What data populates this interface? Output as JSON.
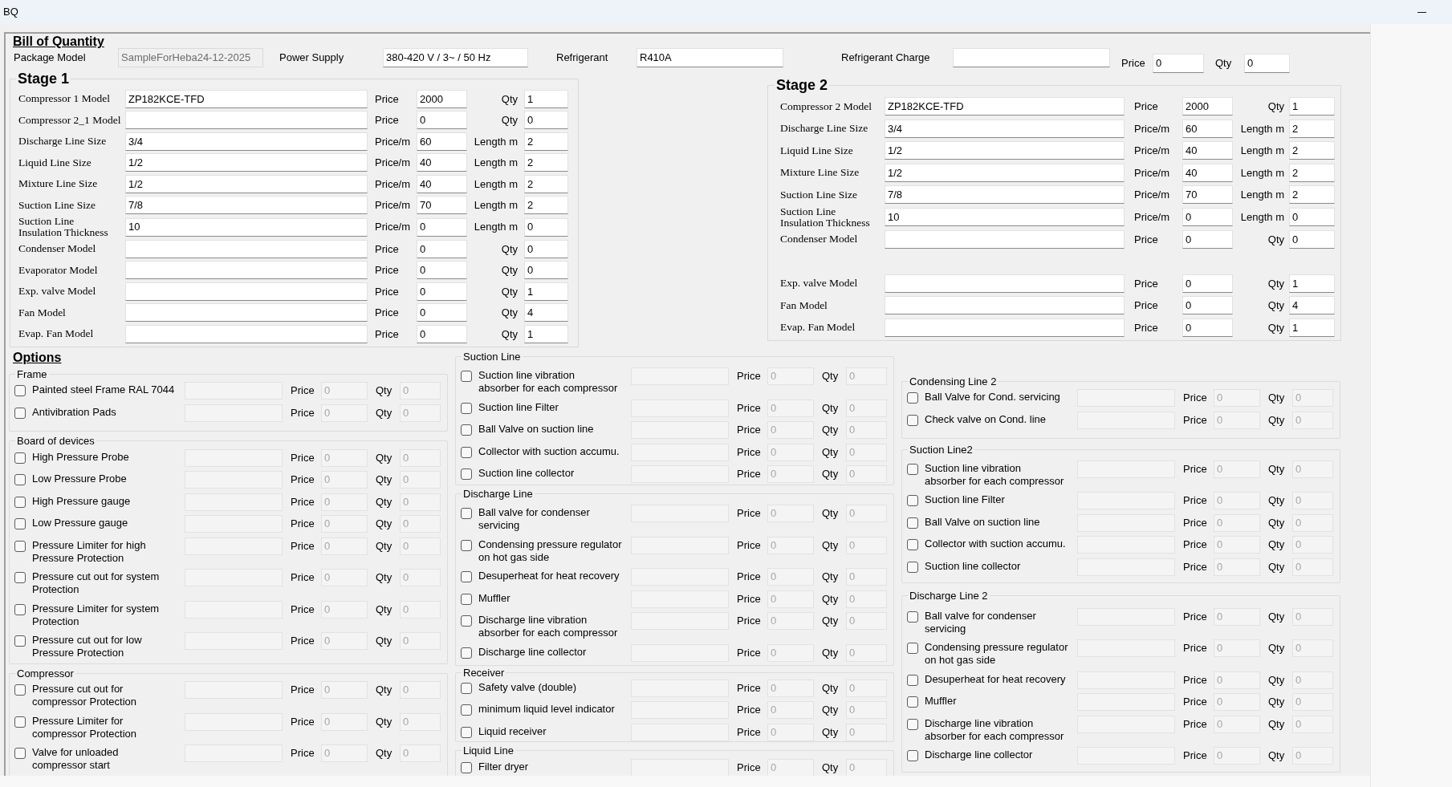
{
  "window": {
    "title": "BQ"
  },
  "header": {
    "title": "Bill of Quantity",
    "fields": [
      {
        "label": "Package Model",
        "value": "SampleForHeba24-12-2025",
        "disabled": true
      },
      {
        "label": "Power Supply",
        "value": "380-420 V / 3~ / 50 Hz",
        "disabled": false
      },
      {
        "label": "Refrigerant",
        "value": "R410A",
        "disabled": false
      },
      {
        "label": "Refrigerant Charge",
        "disabled": false
      }
    ],
    "price_label": "Price",
    "price": "0",
    "quantity_label": "Qty",
    "quantity": "0"
  },
  "stage_1": {
    "title": "Stage 1",
    "rows": [
      {
        "label": "Compressor 1 Model",
        "value": "ZP182KCE-TFD",
        "price_label": "Price",
        "price": "2000",
        "quantity_label": "Qty",
        "quantity": "1"
      },
      {
        "label": "Compressor 2_1 Model",
        "price_label": "Price",
        "price": "0",
        "quantity_label": "Qty",
        "quantity": "0"
      },
      {
        "label": "Discharge Line Size",
        "value": "3/4",
        "price_label": "Price/m",
        "price": "60",
        "quantity_label": "Length m",
        "quantity": "2"
      },
      {
        "label": "Liquid Line Size",
        "value": "1/2",
        "price_label": "Price/m",
        "price": "40",
        "quantity_label": "Length m",
        "quantity": "2"
      },
      {
        "label": "Mixture Line Size",
        "value": "1/2",
        "price_label": "Price/m",
        "price": "40",
        "quantity_label": "Length m",
        "quantity": "2"
      },
      {
        "label": "Suction Line Size",
        "value": "7/8",
        "price_label": "Price/m",
        "price": "70",
        "quantity_label": "Length m",
        "quantity": "2"
      },
      {
        "label": "Suction Line\nInsulation Thickness",
        "value": "10",
        "price_label": "Price/m",
        "price": "0",
        "quantity_label": "Length m",
        "quantity": "0"
      },
      {
        "label": "Condenser Model",
        "price_label": "Price",
        "price": "0",
        "quantity_label": "Qty",
        "quantity": "0"
      },
      {
        "label": "Evaporator Model",
        "price_label": "Price",
        "price": "0",
        "quantity_label": "Qty",
        "quantity": "0"
      },
      {
        "label": "Exp. valve Model",
        "price_label": "Price",
        "price": "0",
        "quantity_label": "Qty",
        "quantity": "1"
      },
      {
        "label": "Fan Model",
        "price_label": "Price",
        "price": "0",
        "quantity_label": "Qty",
        "quantity": "4"
      },
      {
        "label": "Evap. Fan Model",
        "price_label": "Price",
        "price": "0",
        "quantity_label": "Qty",
        "quantity": "1"
      }
    ]
  },
  "stage_2": {
    "title": "Stage 2",
    "row_groups": [
      [
        {
          "label": "Compressor 2 Model",
          "value": "ZP182KCE-TFD",
          "price_label": "Price",
          "price": "2000",
          "quantity_label": "Qty",
          "quantity": "1"
        },
        {
          "label": "Discharge Line Size",
          "value": "3/4",
          "price_label": "Price/m",
          "price": "60",
          "quantity_label": "Length m",
          "quantity": "2"
        },
        {
          "label": "Liquid Line Size",
          "value": "1/2",
          "price_label": "Price/m",
          "price": "40",
          "quantity_label": "Length m",
          "quantity": "2"
        },
        {
          "label": "Mixture Line Size",
          "value": "1/2",
          "price_label": "Price/m",
          "price": "40",
          "quantity_label": "Length m",
          "quantity": "2"
        },
        {
          "label": "Suction Line Size",
          "value": "7/8",
          "price_label": "Price/m",
          "price": "70",
          "quantity_label": "Length m",
          "quantity": "2"
        },
        {
          "label": "Suction Line\nInsulation Thickness",
          "value": "10",
          "price_label": "Price/m",
          "price": "0",
          "quantity_label": "Length m",
          "quantity": "0"
        },
        {
          "label": "Condenser Model",
          "price_label": "Price",
          "price": "0",
          "quantity_label": "Qty",
          "quantity": "0"
        }
      ],
      [
        {
          "label": "Exp. valve Model",
          "price_label": "Price",
          "price": "0",
          "quantity_label": "Qty",
          "quantity": "1"
        },
        {
          "label": "Fan Model",
          "price_label": "Price",
          "price": "0",
          "quantity_label": "Qty",
          "quantity": "4"
        },
        {
          "label": "Evap. Fan Model",
          "price_label": "Price",
          "price": "0",
          "quantity_label": "Qty",
          "quantity": "1"
        }
      ]
    ]
  },
  "options": {
    "title": "Options",
    "columns": [
      {
        "groups": [
          {
            "title": "Frame",
            "items": [
              {
                "label": "Painted steel Frame RAL 7044",
                "checked": false,
                "disabled": true,
                "price_label": "Price",
                "price": "0",
                "quantity_label": "Qty",
                "quantity": "0"
              },
              {
                "label": "Antivibration Pads",
                "checked": false,
                "disabled": true,
                "price_label": "Price",
                "price": "0",
                "quantity_label": "Qty",
                "quantity": "0"
              }
            ]
          },
          {
            "title": "Board of devices",
            "items": [
              {
                "label": "High Pressure Probe",
                "checked": false,
                "disabled": true,
                "price_label": "Price",
                "price": "0",
                "quantity_label": "Qty",
                "quantity": "0"
              },
              {
                "label": "Low Pressure Probe",
                "checked": false,
                "disabled": true,
                "price_label": "Price",
                "price": "0",
                "quantity_label": "Qty",
                "quantity": "0"
              },
              {
                "label": "High Pressure gauge",
                "checked": false,
                "disabled": true,
                "price_label": "Price",
                "price": "0",
                "quantity_label": "Qty",
                "quantity": "0"
              },
              {
                "label": "Low Pressure gauge",
                "checked": false,
                "disabled": true,
                "price_label": "Price",
                "price": "0",
                "quantity_label": "Qty",
                "quantity": "0"
              },
              {
                "label": "Pressure Limiter for high\nPressure Protection",
                "checked": false,
                "disabled": true,
                "price_label": "Price",
                "price": "0",
                "quantity_label": "Qty",
                "quantity": "0"
              },
              {
                "label": "Pressure cut out for system\nProtection",
                "checked": false,
                "disabled": true,
                "price_label": "Price",
                "price": "0",
                "quantity_label": "Qty",
                "quantity": "0"
              },
              {
                "label": "Pressure Limiter for system\nProtection",
                "checked": false,
                "disabled": true,
                "price_label": "Price",
                "price": "0",
                "quantity_label": "Qty",
                "quantity": "0"
              },
              {
                "label": "Pressure cut out for low\nPressure Protection",
                "checked": false,
                "disabled": true,
                "price_label": "Price",
                "price": "0",
                "quantity_label": "Qty",
                "quantity": "0"
              }
            ]
          },
          {
            "title": "Compressor",
            "items": [
              {
                "label": "Pressure cut out for\ncompressor Protection",
                "checked": false,
                "disabled": true,
                "price_label": "Price",
                "price": "0",
                "quantity_label": "Qty",
                "quantity": "0"
              },
              {
                "label": "Pressure Limiter for\ncompressor Protection",
                "checked": false,
                "disabled": true,
                "price_label": "Price",
                "price": "0",
                "quantity_label": "Qty",
                "quantity": "0"
              },
              {
                "label": "Valve for unloaded\ncompressor start",
                "checked": false,
                "disabled": true,
                "price_label": "Price",
                "price": "0",
                "quantity_label": "Qty",
                "quantity": "0"
              }
            ]
          }
        ]
      },
      {
        "groups": [
          {
            "title": "Suction Line",
            "items": [
              {
                "label": "Suction line vibration\nabsorber for each compressor",
                "checked": false,
                "disabled": true,
                "price_label": "Price",
                "price": "0",
                "quantity_label": "Qty",
                "quantity": "0"
              },
              {
                "label": "Suction line Filter",
                "checked": false,
                "disabled": true,
                "price_label": "Price",
                "price": "0",
                "quantity_label": "Qty",
                "quantity": "0"
              },
              {
                "label": "Ball Valve on suction line",
                "checked": false,
                "disabled": true,
                "price_label": "Price",
                "price": "0",
                "quantity_label": "Qty",
                "quantity": "0"
              },
              {
                "label": "Collector with suction accumu.",
                "checked": false,
                "disabled": true,
                "price_label": "Price",
                "price": "0",
                "quantity_label": "Qty",
                "quantity": "0"
              },
              {
                "label": "Suction line collector",
                "checked": false,
                "disabled": true,
                "price_label": "Price",
                "price": "0",
                "quantity_label": "Qty",
                "quantity": "0"
              }
            ]
          },
          {
            "title": "Discharge Line",
            "items": [
              {
                "label": "Ball valve for condenser\nservicing",
                "checked": false,
                "disabled": true,
                "price_label": "Price",
                "price": "0",
                "quantity_label": "Qty",
                "quantity": "0"
              },
              {
                "label": "Condensing pressure regulator\non hot gas side",
                "checked": false,
                "disabled": true,
                "price_label": "Price",
                "price": "0",
                "quantity_label": "Qty",
                "quantity": "0"
              },
              {
                "label": "Desuperheat for heat recovery",
                "checked": false,
                "disabled": true,
                "price_label": "Price",
                "price": "0",
                "quantity_label": "Qty",
                "quantity": "0"
              },
              {
                "label": "Muffler",
                "checked": false,
                "disabled": true,
                "price_label": "Price",
                "price": "0",
                "quantity_label": "Qty",
                "quantity": "0"
              },
              {
                "label": "Discharge line vibration\nabsorber for each compressor",
                "checked": false,
                "disabled": true,
                "price_label": "Price",
                "price": "0",
                "quantity_label": "Qty",
                "quantity": "0"
              },
              {
                "label": "Discharge line collector",
                "checked": false,
                "disabled": true,
                "price_label": "Price",
                "price": "0",
                "quantity_label": "Qty",
                "quantity": "0"
              }
            ]
          },
          {
            "title": "Receiver",
            "items": [
              {
                "label": "Safety valve (double)",
                "checked": false,
                "disabled": true,
                "price_label": "Price",
                "price": "0",
                "quantity_label": "Qty",
                "quantity": "0"
              },
              {
                "label": "minimum liquid level indicator",
                "checked": false,
                "disabled": true,
                "price_label": "Price",
                "price": "0",
                "quantity_label": "Qty",
                "quantity": "0"
              },
              {
                "label": "Liquid receiver",
                "checked": false,
                "disabled": true,
                "price_label": "Price",
                "price": "0",
                "quantity_label": "Qty",
                "quantity": "0"
              }
            ]
          },
          {
            "title": "Liquid Line",
            "items": [
              {
                "label": "Filter dryer",
                "checked": false,
                "disabled": true,
                "price_label": "Price",
                "price": "0",
                "quantity_label": "Qty",
                "quantity": "0"
              }
            ]
          }
        ]
      },
      {
        "groups": [
          {
            "title": "Condensing Line 2",
            "items": [
              {
                "label": "Ball Valve for Cond. servicing",
                "checked": false,
                "disabled": true,
                "price_label": "Price",
                "price": "0",
                "quantity_label": "Qty",
                "quantity": "0"
              },
              {
                "label": "Check valve on Cond. line",
                "checked": false,
                "disabled": true,
                "price_label": "Price",
                "price": "0",
                "quantity_label": "Qty",
                "quantity": "0"
              }
            ]
          },
          {
            "title": "Suction Line2",
            "items": [
              {
                "label": "Suction line vibration\nabsorber for each compressor",
                "checked": false,
                "disabled": true,
                "price_label": "Price",
                "price": "0",
                "quantity_label": "Qty",
                "quantity": "0"
              },
              {
                "label": "Suction line Filter",
                "checked": false,
                "disabled": true,
                "price_label": "Price",
                "price": "0",
                "quantity_label": "Qty",
                "quantity": "0"
              },
              {
                "label": "Ball Valve on suction line",
                "checked": false,
                "disabled": true,
                "price_label": "Price",
                "price": "0",
                "quantity_label": "Qty",
                "quantity": "0"
              },
              {
                "label": "Collector with suction accumu.",
                "checked": false,
                "disabled": true,
                "price_label": "Price",
                "price": "0",
                "quantity_label": "Qty",
                "quantity": "0"
              },
              {
                "label": "Suction line collector",
                "checked": false,
                "disabled": true,
                "price_label": "Price",
                "price": "0",
                "quantity_label": "Qty",
                "quantity": "0"
              }
            ]
          },
          {
            "title": "Discharge Line 2",
            "items": [
              {
                "label": "Ball valve for condenser\nservicing",
                "checked": false,
                "disabled": true,
                "price_label": "Price",
                "price": "0",
                "quantity_label": "Qty",
                "quantity": "0"
              },
              {
                "label": "Condensing pressure regulator\non hot gas side",
                "checked": false,
                "disabled": true,
                "price_label": "Price",
                "price": "0",
                "quantity_label": "Qty",
                "quantity": "0"
              },
              {
                "label": "Desuperheat for heat recovery",
                "checked": false,
                "disabled": true,
                "price_label": "Price",
                "price": "0",
                "quantity_label": "Qty",
                "quantity": "0"
              },
              {
                "label": "Muffler",
                "checked": false,
                "disabled": true,
                "price_label": "Price",
                "price": "0",
                "quantity_label": "Qty",
                "quantity": "0"
              },
              {
                "label": "Discharge line vibration\nabsorber for each compressor",
                "checked": false,
                "disabled": true,
                "price_label": "Price",
                "price": "0",
                "quantity_label": "Qty",
                "quantity": "0"
              },
              {
                "label": "Discharge line collector",
                "checked": false,
                "disabled": true,
                "price_label": "Price",
                "price": "0",
                "quantity_label": "Qty",
                "quantity": "0"
              }
            ]
          }
        ]
      }
    ]
  }
}
